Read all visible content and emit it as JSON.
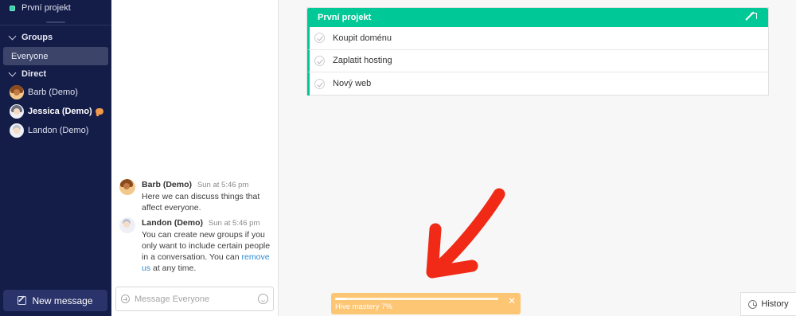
{
  "sidebar": {
    "project_label": "První projekt",
    "groups_header": "Groups",
    "groups": [
      {
        "label": "Everyone",
        "active": true
      }
    ],
    "direct_header": "Direct",
    "direct": [
      {
        "label": "Barb (Demo)",
        "avatar": "barb-avatar",
        "unread": false
      },
      {
        "label": "Jessica (Demo)",
        "avatar": "jessica-avatar",
        "unread": true
      },
      {
        "label": "Landon (Demo)",
        "avatar": "landon-avatar",
        "unread": false
      }
    ],
    "new_message_label": "New message"
  },
  "chat": {
    "messages": [
      {
        "author": "Barb (Demo)",
        "time": "Sun at 5:46 pm",
        "text": "Here we can discuss things that affect everyone."
      },
      {
        "author": "Landon (Demo)",
        "time": "Sun at 5:46 pm",
        "text_before_link": "You can create new groups if you only want to include certain people in a conversation. You can ",
        "link_text": "remove us",
        "text_after_link": " at any time."
      }
    ],
    "composer_placeholder": "Message Everyone"
  },
  "project_card": {
    "title": "První projekt",
    "tasks": [
      "Koupit doménu",
      "Zaplatit hosting",
      "Nový web"
    ]
  },
  "mastery": {
    "label": "Hive mastery 7%",
    "progress_percent": 7,
    "close_glyph": "✕"
  },
  "history_label": "History",
  "colors": {
    "sidebar_bg": "#141c48",
    "accent_green": "#00c896",
    "mastery_orange": "#fdc674",
    "annotation_red": "#f02a17",
    "unread_orange": "#f2994a",
    "link_blue": "#2a8bd8"
  }
}
